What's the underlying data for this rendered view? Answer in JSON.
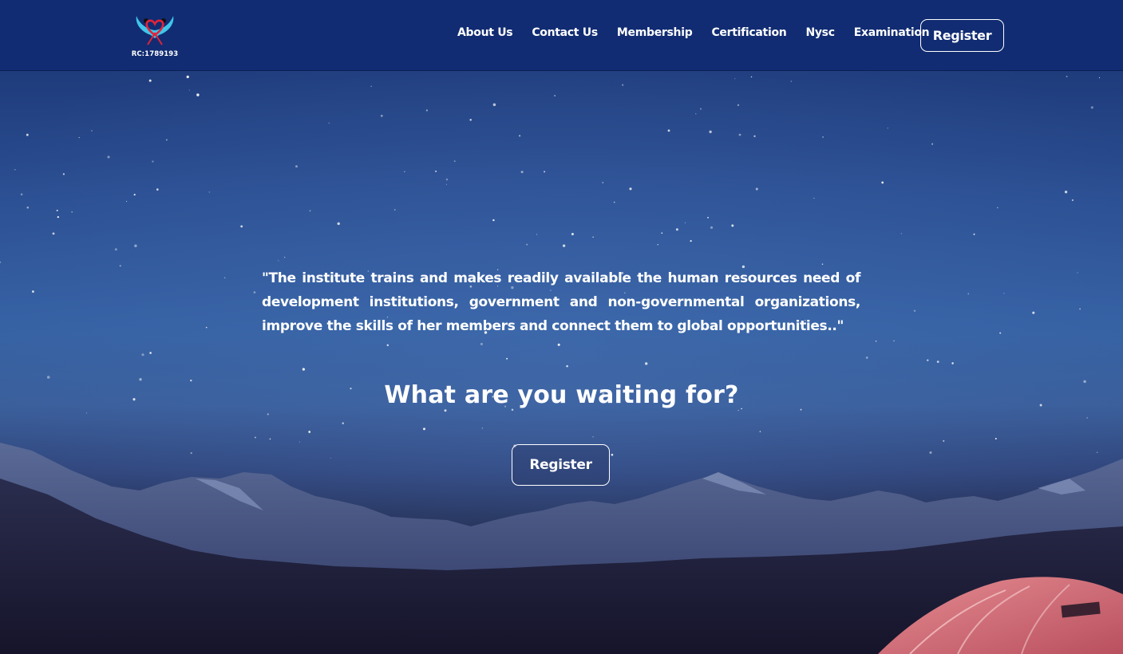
{
  "nav": {
    "logo_text": "RC:1789193",
    "links": [
      "About Us",
      "Contact Us",
      "Membership",
      "Certification",
      "Nysc",
      "Examination"
    ],
    "register_label": "Register"
  },
  "hero": {
    "quote": "\"The institute trains and makes readily available the human resources need of development institutions, government and non-governmental organizations, improve the skills of her members and connect them to global opportunities..\"",
    "heading": "What are you waiting for?",
    "register_label": "Register"
  },
  "colors": {
    "nav_bg": "#112c72",
    "sky_top": "#17306f",
    "sky_mid": "#3561a3",
    "tent": "#d9707a"
  }
}
